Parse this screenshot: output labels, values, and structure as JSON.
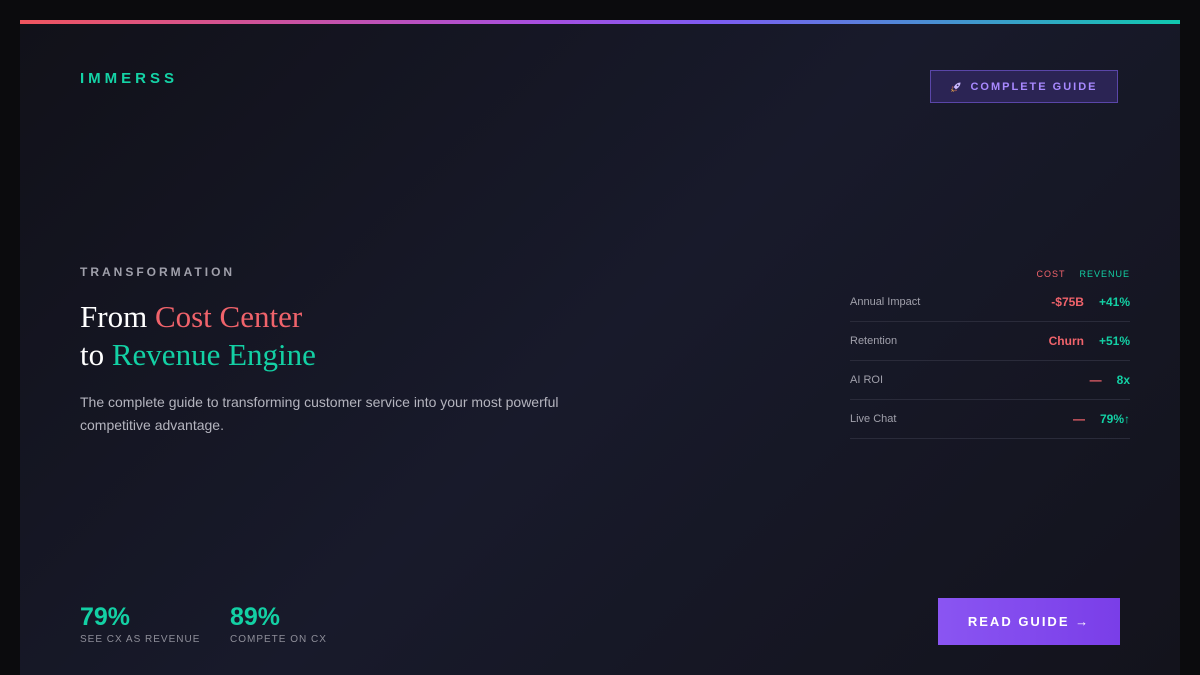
{
  "brand": {
    "name": "IMMERSS"
  },
  "badge": {
    "icon": "rocket-icon",
    "label": "COMPLETE GUIDE"
  },
  "hero": {
    "eyebrow": "TRANSFORMATION",
    "headline_from": "From ",
    "headline_cost": "Cost Center",
    "headline_to": "to ",
    "headline_revenue": "Revenue Engine",
    "subtitle": "The complete guide to transforming customer service into your most powerful competitive advantage."
  },
  "comparison": {
    "headers": {
      "cost": "COST",
      "revenue": "REVENUE"
    },
    "rows": [
      {
        "label": "Annual Impact",
        "cost": "-$75B",
        "revenue": "+41%"
      },
      {
        "label": "Retention",
        "cost": "Churn",
        "revenue": "+51%"
      },
      {
        "label": "AI ROI",
        "cost": "—",
        "revenue": "8x"
      },
      {
        "label": "Live Chat",
        "cost": "—",
        "revenue": "79%↑"
      }
    ]
  },
  "stats": [
    {
      "value": "79%",
      "label": "SEE CX AS REVENUE"
    },
    {
      "value": "89%",
      "label": "COMPETE ON CX"
    }
  ],
  "cta": {
    "label": "READ GUIDE →"
  },
  "colors": {
    "accent_green": "#13d0a4",
    "accent_red": "#f0636b",
    "accent_purple": "#8a55f2"
  }
}
